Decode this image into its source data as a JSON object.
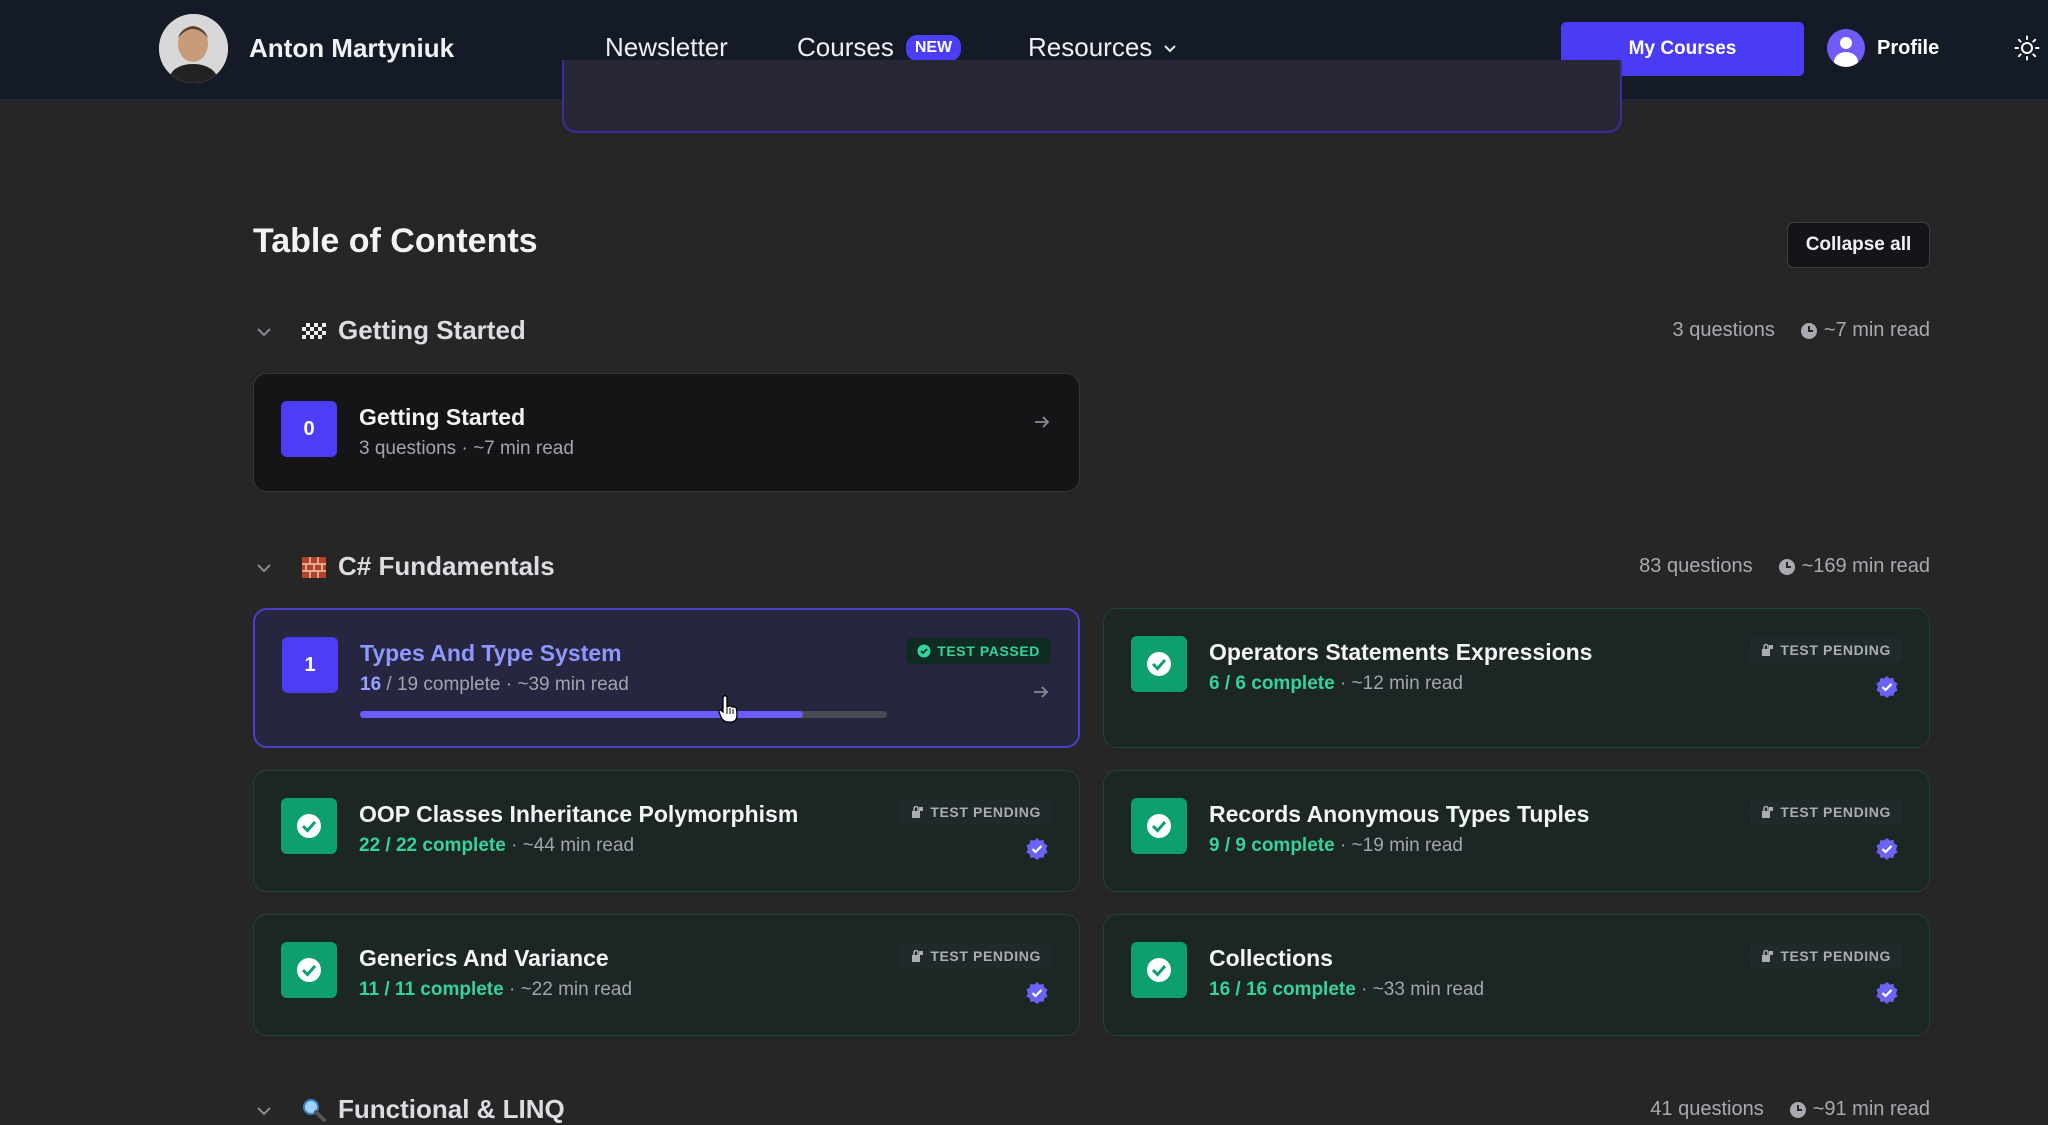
{
  "header": {
    "brand_name": "Anton Martyniuk",
    "nav": {
      "newsletter": "Newsletter",
      "courses": "Courses",
      "courses_badge": "NEW",
      "resources": "Resources"
    },
    "my_courses_label": "My Courses",
    "profile_label": "Profile"
  },
  "toc": {
    "title": "Table of Contents",
    "collapse_label": "Collapse all"
  },
  "sections": {
    "getting_started": {
      "title": "Getting Started",
      "questions": "3 questions",
      "read": "~7 min read",
      "card": {
        "number": "0",
        "title": "Getting Started",
        "sub": "3 questions · ~7 min read"
      }
    },
    "fundamentals": {
      "title": "C# Fundamentals",
      "questions": "83 questions",
      "read": "~169 min read",
      "cards": [
        {
          "number": "1",
          "title": "Types And Type System",
          "done": "16",
          "rest": " / 19 complete",
          "read": " · ~39 min read",
          "badge": "TEST PASSED",
          "progress": 0.84
        },
        {
          "title": "Operators Statements Expressions",
          "done": "6 / 6 complete",
          "read": " · ~12 min read",
          "badge": "TEST PENDING"
        },
        {
          "title": "OOP Classes Inheritance Polymorphism",
          "done": "22 / 22 complete",
          "read": " · ~44 min read",
          "badge": "TEST PENDING"
        },
        {
          "title": "Records Anonymous Types Tuples",
          "done": "9 / 9 complete",
          "read": " · ~19 min read",
          "badge": "TEST PENDING"
        },
        {
          "title": "Generics And Variance",
          "done": "11 / 11 complete",
          "read": " · ~22 min read",
          "badge": "TEST PENDING"
        },
        {
          "title": "Collections",
          "done": "16 / 16 complete",
          "read": " · ~33 min read",
          "badge": "TEST PENDING"
        }
      ]
    },
    "functional": {
      "title": "Functional & LINQ",
      "questions": "41 questions",
      "read": "~91 min read"
    }
  },
  "colors": {
    "accent": "#4a3cf5",
    "success": "#34d399",
    "background": "#262626"
  },
  "icons": [
    "chevron-down-icon",
    "sun-icon",
    "clock-icon",
    "arrow-right-icon",
    "check-badge-icon",
    "verified-icon",
    "lock-icon"
  ]
}
